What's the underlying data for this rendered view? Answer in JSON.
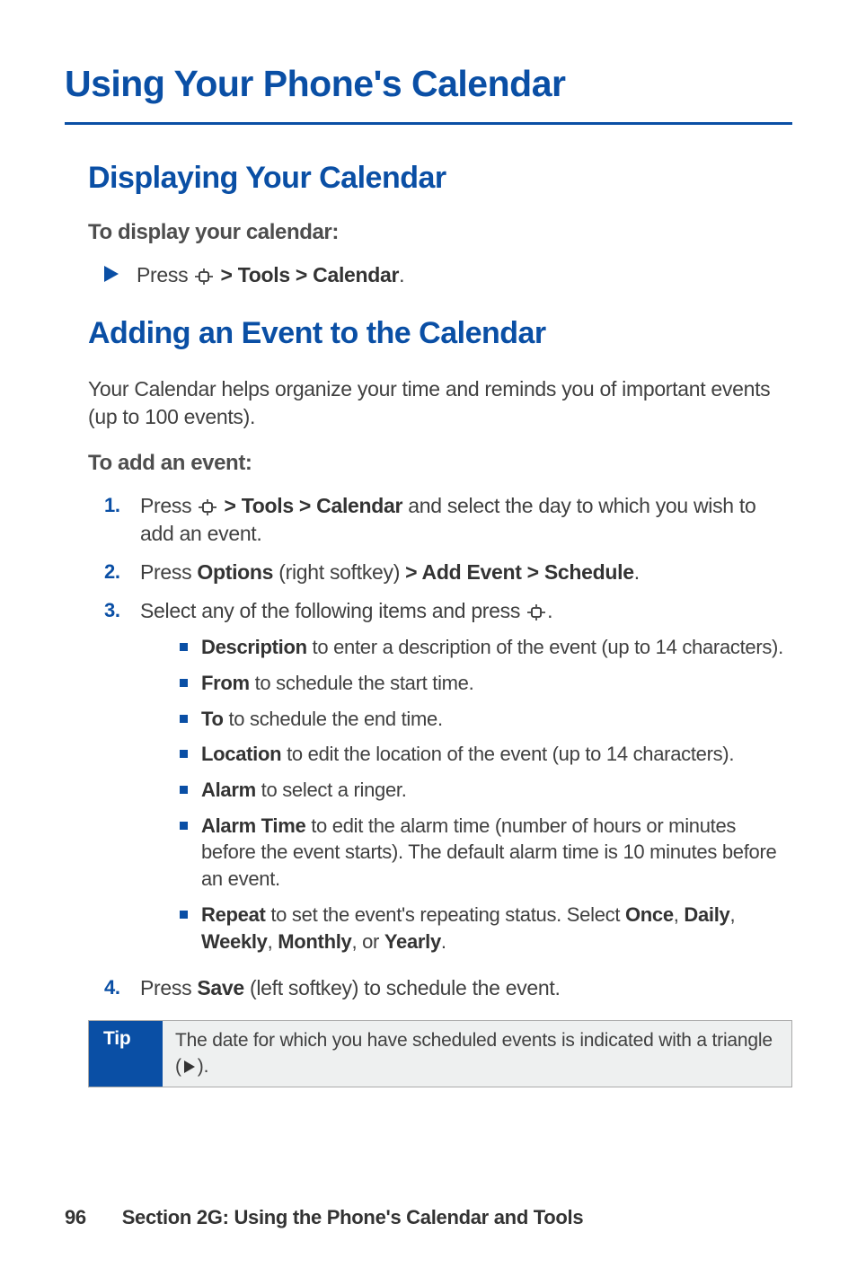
{
  "title": "Using Your Phone's Calendar",
  "section1": {
    "heading": "Displaying Your Calendar",
    "sub": "To display your calendar:",
    "step": {
      "pre": "Press ",
      "nav": "> Tools > Calendar",
      "post": "."
    }
  },
  "section2": {
    "heading": "Adding an Event to the Calendar",
    "intro": "Your Calendar helps organize your time and reminds you of important events (up to 100 events).",
    "sub": "To add an event:",
    "steps": [
      {
        "n": "1.",
        "pre": "Press ",
        "bold1": "> Tools > Calendar",
        "post": " and select the day to which you wish to add an event."
      },
      {
        "n": "2.",
        "pre": "Press ",
        "bold1": "Options",
        "mid": " (right softkey) ",
        "bold2": "> Add Event > Schedule",
        "post": "."
      },
      {
        "n": "3.",
        "pre": "Select any of the following items and press ",
        "post": "."
      },
      {
        "n": "4.",
        "pre": "Press ",
        "bold1": "Save",
        "post": " (left softkey) to schedule the event."
      }
    ],
    "subitems": [
      {
        "bold": "Description",
        "text": " to enter a description of the event (up to 14 characters)."
      },
      {
        "bold": "From",
        "text": " to schedule the start time."
      },
      {
        "bold": "To",
        "text": " to schedule the end time."
      },
      {
        "bold": "Location",
        "text": " to edit the location of the event (up to 14 characters)."
      },
      {
        "bold": "Alarm",
        "text": " to select a ringer."
      },
      {
        "bold": "Alarm Time",
        "text": " to edit the alarm time (number of hours or minutes before the event starts). The default alarm time is 10 minutes before an event."
      },
      {
        "bold": "Repeat",
        "text_pre": " to set the event's repeating status. Select ",
        "o1": "Once",
        "o2": "Daily",
        "o3": "Weekly",
        "o4": "Monthly",
        "o5": "Yearly",
        "text_post": "."
      }
    ]
  },
  "tip": {
    "label": "Tip",
    "text_pre": "The date for which you have scheduled events is indicated with a triangle (",
    "text_post": ")."
  },
  "footer": {
    "page": "96",
    "section": "Section 2G: Using the Phone's Calendar and Tools"
  }
}
